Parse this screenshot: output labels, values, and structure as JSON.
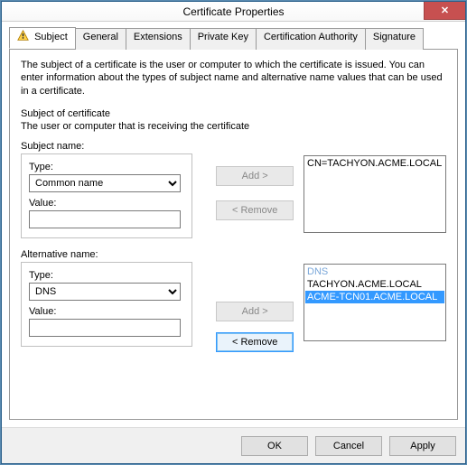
{
  "window": {
    "title": "Certificate Properties"
  },
  "tabs": [
    {
      "label": "Subject"
    },
    {
      "label": "General"
    },
    {
      "label": "Extensions"
    },
    {
      "label": "Private Key"
    },
    {
      "label": "Certification Authority"
    },
    {
      "label": "Signature"
    }
  ],
  "subject": {
    "description": "The subject of a certificate is the user or computer to which the certificate is issued. You can enter information about the types of subject name and alternative name values that can be used in a certificate.",
    "section_title": "Subject of certificate",
    "section_sub": "The user or computer that is receiving the certificate",
    "subject_name_label": "Subject name:",
    "alt_name_label": "Alternative name:",
    "type_label": "Type:",
    "value_label": "Value:",
    "subject_type_value": "Common name",
    "subject_value_value": "",
    "alt_type_value": "DNS",
    "alt_value_value": "",
    "add_label": "Add >",
    "remove_label": "< Remove",
    "subject_list": [
      "CN=TACHYON.ACME.LOCAL"
    ],
    "alt_list_header": "DNS",
    "alt_list": [
      "TACHYON.ACME.LOCAL",
      "ACME-TCN01.ACME.LOCAL"
    ]
  },
  "buttons": {
    "ok": "OK",
    "cancel": "Cancel",
    "apply": "Apply"
  }
}
